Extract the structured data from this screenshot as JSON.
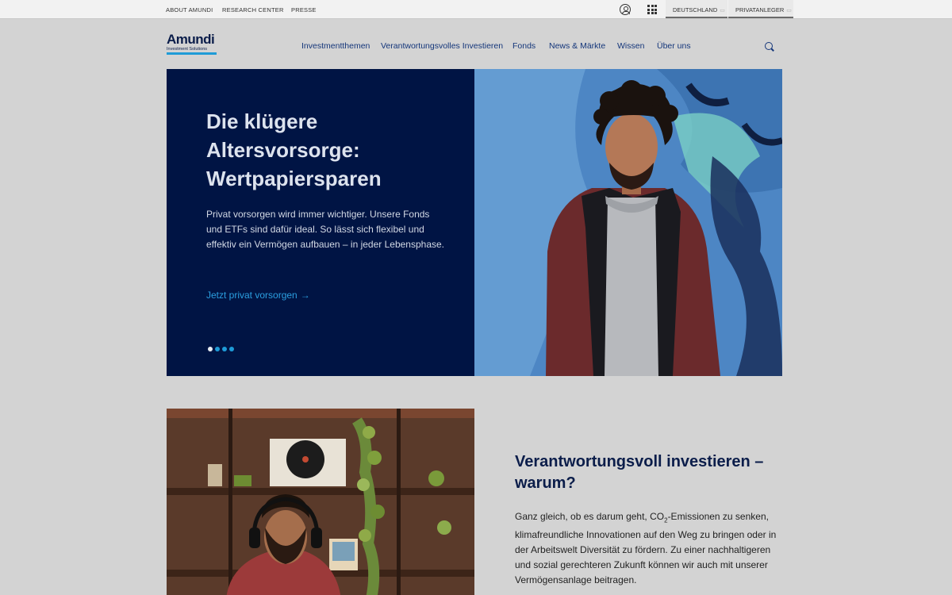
{
  "topbar": {
    "links": [
      "ABOUT AMUNDI",
      "RESEARCH CENTER",
      "PRESSE"
    ],
    "country_selector": "DEUTSCHLAND",
    "audience_selector": "PRIVATANLEGER",
    "chevron": "▭"
  },
  "header": {
    "logo_wordmark": "Amundi",
    "logo_tagline": "Investment Solutions",
    "nav": [
      "Investmentthemen",
      "Verantwortungsvolles Investieren",
      "Fonds",
      "News & Märkte",
      "Wissen",
      "Über uns"
    ]
  },
  "hero": {
    "title": "Die klügere Altersvorsorge: Wertpapiersparen",
    "text": "Privat vorsorgen wird immer wichtiger. Unsere Fonds und ETFs sind dafür ideal. So lässt sich flexibel und effektiv ein Vermögen aufbauen – in jeder Lebensphase.",
    "link_label": "Jetzt privat vorsorgen",
    "link_arrow": "→",
    "slide_count": 4,
    "active_slide": 1
  },
  "section": {
    "title": "Verantwortungsvoll investieren – warum?",
    "text_before": "Ganz gleich, ob es darum geht, CO",
    "text_sub": "2",
    "text_after": "-Emissionen zu senken, klimafreundliche Innovationen auf den Weg zu bringen oder in der Arbeitswelt Diversität zu fördern. Zu einer nachhaltigeren und sozial gerechteren Zukunft können wir auch mit unserer Vermögensanlage beitragen."
  },
  "colors": {
    "hero_panel": "#001444",
    "accent": "#1e9bd7",
    "nav_text": "#14367a",
    "page_bg": "#d3d3d3"
  },
  "icons": [
    "user-icon",
    "apps-grid-icon",
    "search-icon",
    "arrow-right-icon"
  ]
}
